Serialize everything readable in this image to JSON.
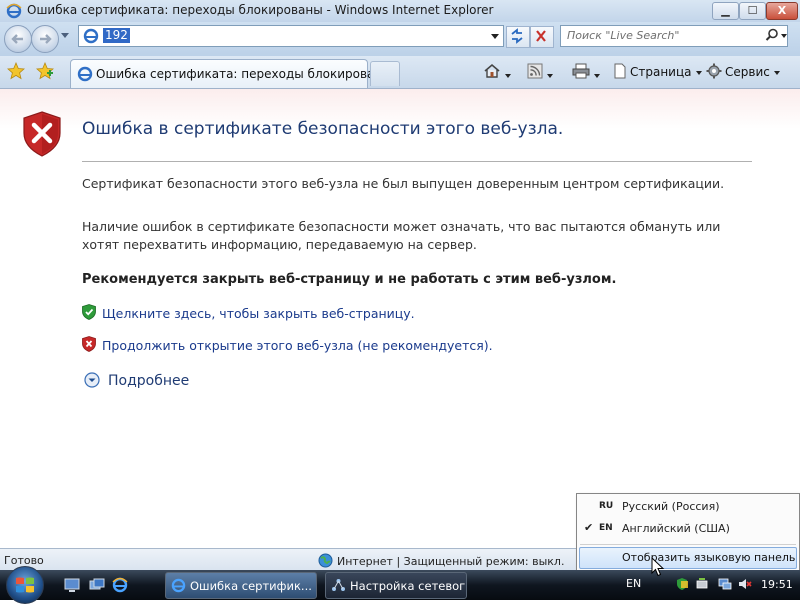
{
  "window": {
    "title": "Ошибка сертификата: переходы блокированы - Windows Internet Explorer",
    "minimize_glyph": "▁",
    "maximize_glyph": "☐",
    "close_glyph": "X"
  },
  "address": {
    "value": "192",
    "search_placeholder": "Поиск \"Live Search\""
  },
  "tabs": [
    {
      "label": "Ошибка сертификата: переходы блокированы"
    }
  ],
  "commands": {
    "page_label": "Страница",
    "tools_label": "Сервис"
  },
  "content": {
    "heading": "Ошибка в сертификате безопасности этого веб-узла.",
    "paragraph1": "Сертификат безопасности этого веб-узла не был выпущен доверенным центром сертификации.",
    "paragraph2": "Наличие ошибок в сертификате безопасности может означать, что вас пытаются обмануть или хотят перехватить информацию, передаваемую на сервер.",
    "recommendation": "Рекомендуется закрыть веб-страницу и не работать с этим веб-узлом.",
    "close_link": "Щелкните здесь, чтобы закрыть веб-страницу.",
    "continue_link": "Продолжить открытие этого веб-узла (не рекомендуется).",
    "more_info": "Подробнее"
  },
  "status": {
    "text": "Готово",
    "zone": "Интернет | Защищенный режим: выкл."
  },
  "language_menu": {
    "items": [
      {
        "code": "RU",
        "name": "Русский (Россия)",
        "checked": false
      },
      {
        "code": "EN",
        "name": "Английский (США)",
        "checked": true,
        "check_glyph": "✔"
      }
    ],
    "show_bar": "Отобразить языковую панель"
  },
  "taskbar": {
    "tasks": [
      {
        "label": "Ошибка сертифик..."
      },
      {
        "label": "Настройка сетевог..."
      }
    ],
    "lang": "EN",
    "clock": "19:51"
  },
  "colors": {
    "accent": "#1f3b73",
    "link": "#1a3a8c",
    "error_red": "#c62828",
    "ok_green": "#2e9b3a",
    "selection": "#3169c6"
  }
}
